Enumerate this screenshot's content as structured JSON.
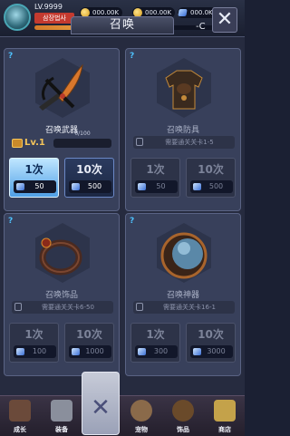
{
  "header": {
    "level": "LV.9999",
    "username": "삼장법사",
    "currencies": [
      {
        "value": "000.00K",
        "icon": "gold-coin-icon"
      },
      {
        "value": "000.00K",
        "icon": "gold-coin-icon"
      },
      {
        "value": "000.0K",
        "icon": "gem-icon"
      }
    ],
    "timer": "-C"
  },
  "title": "召唤",
  "cards": [
    {
      "name": "召唤武器",
      "art": "weapon-icon",
      "level": "Lv.1",
      "progress": "0/100",
      "progress_fraction": 0.0,
      "buttons": [
        {
          "count": "1次",
          "cost": "50"
        },
        {
          "count": "10次",
          "cost": "500"
        }
      ]
    },
    {
      "name": "召唤防具",
      "art": "armor-icon",
      "lock_text": "需要通关关卡1-5",
      "buttons": [
        {
          "count": "1次",
          "cost": "50"
        },
        {
          "count": "10次",
          "cost": "500"
        }
      ]
    },
    {
      "name": "召唤饰品",
      "art": "bracelet-icon",
      "lock_text": "需要通关关卡6-50",
      "buttons": [
        {
          "count": "1次",
          "cost": "100"
        },
        {
          "count": "10次",
          "cost": "1000"
        }
      ]
    },
    {
      "name": "召唤神器",
      "art": "orb-icon",
      "lock_text": "需要通关关卡16-1",
      "buttons": [
        {
          "count": "1次",
          "cost": "300"
        },
        {
          "count": "10次",
          "cost": "3000"
        }
      ]
    }
  ],
  "nav": [
    {
      "label": "成长"
    },
    {
      "label": "装备"
    },
    {
      "label": "宠物"
    },
    {
      "label": "饰品"
    },
    {
      "label": "商店"
    }
  ],
  "colors": {
    "accent": "#4ec2ff",
    "primary_button": "#6fb8f0",
    "panel": "#38405b"
  }
}
